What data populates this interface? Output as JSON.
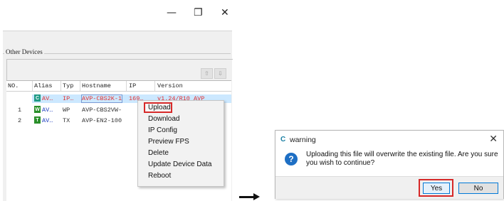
{
  "window": {
    "minimize_glyph": "—",
    "maximize_glyph": "❐",
    "close_glyph": "✕"
  },
  "group": {
    "title": "Other Devices",
    "tool_icon_1": "arrow-up-icon",
    "tool_icon_2": "arrow-down-icon",
    "tool_1_glyph": "⇧",
    "tool_2_glyph": "⇩"
  },
  "list": {
    "headers": [
      "NO.",
      "Alias",
      "Typ",
      "Hostname",
      "IP",
      "Version"
    ],
    "rows": [
      {
        "no": "",
        "badge": "C",
        "alias": "AV…",
        "type": "IP…",
        "hostname": "AVP-CBS2K-1",
        "ip": "169…",
        "version": "v1.24/R10 AVP"
      },
      {
        "no": "1",
        "badge": "W",
        "alias": "AV…",
        "type": "WP",
        "hostname": "AVP-CBS2VW-",
        "ip": "",
        "version": ""
      },
      {
        "no": "2",
        "badge": "T",
        "alias": "AV…",
        "type": "TX",
        "hostname": "AVP-EN2-100",
        "ip": "",
        "version": ""
      }
    ]
  },
  "context_menu": {
    "items": [
      "Upload",
      "Download",
      "IP Config",
      "Preview FPS",
      "Delete",
      "Update Device Data",
      "Reboot"
    ]
  },
  "dialog": {
    "title": "warning",
    "logo_text": "C",
    "close_glyph": "✕",
    "question_glyph": "?",
    "message": "Uploading this file will overwrite the existing file. Are you sure you wish to continue?",
    "yes_label": "Yes",
    "no_label": "No"
  },
  "colors": {
    "highlight": "#d62828",
    "selection": "#cce8ff",
    "question_icon": "#1e6fc4"
  }
}
